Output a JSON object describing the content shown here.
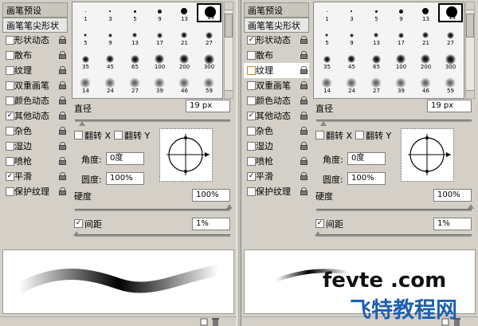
{
  "panels": [
    {
      "sidebar": [
        {
          "label": "画笔预设",
          "kind": "head"
        },
        {
          "label": "画笔笔尖形状",
          "kind": "selected"
        },
        {
          "label": "形状动态",
          "checked": false,
          "lock": true
        },
        {
          "label": "散布",
          "checked": false,
          "lock": true
        },
        {
          "label": "纹理",
          "checked": false,
          "lock": true
        },
        {
          "label": "双重画笔",
          "checked": false,
          "lock": true
        },
        {
          "label": "颜色动态",
          "checked": false,
          "lock": true
        },
        {
          "label": "其他动态",
          "checked": true,
          "lock": true
        },
        {
          "label": "杂色",
          "checked": false,
          "lock": true
        },
        {
          "label": "湿边",
          "checked": false,
          "lock": true
        },
        {
          "label": "喷枪",
          "checked": false,
          "lock": true
        },
        {
          "label": "平滑",
          "checked": true,
          "lock": true
        },
        {
          "label": "保护纹理",
          "checked": false,
          "lock": true
        }
      ],
      "brushes": [
        "1",
        "3",
        "5",
        "9",
        "13",
        "19",
        "5",
        "9",
        "13",
        "17",
        "21",
        "27",
        "35",
        "45",
        "65",
        "100",
        "200",
        "300",
        "14",
        "24",
        "27",
        "39",
        "46",
        "59"
      ],
      "diameter_label": "直径",
      "diameter_value": "19 px",
      "flip_x": "翻转 X",
      "flip_y": "翻转 Y",
      "angle_label": "角度:",
      "angle_value": "0度",
      "roundness_label": "圆度:",
      "roundness_value": "100%",
      "hardness_label": "硬度",
      "hardness_value": "100%",
      "spacing_label": "间距",
      "spacing_value": "1%",
      "spacing_checked": true
    },
    {
      "sidebar": [
        {
          "label": "画笔预设",
          "kind": "head"
        },
        {
          "label": "画笔笔尖形状",
          "kind": "selected"
        },
        {
          "label": "形状动态",
          "checked": true,
          "lock": true
        },
        {
          "label": "散布",
          "checked": false,
          "lock": true
        },
        {
          "label": "纹理",
          "checked": false,
          "lock": true,
          "highlight": true
        },
        {
          "label": "双重画笔",
          "checked": false,
          "lock": true
        },
        {
          "label": "颜色动态",
          "checked": false,
          "lock": true
        },
        {
          "label": "其他动态",
          "checked": true,
          "lock": true
        },
        {
          "label": "杂色",
          "checked": false,
          "lock": true
        },
        {
          "label": "湿边",
          "checked": false,
          "lock": true
        },
        {
          "label": "喷枪",
          "checked": false,
          "lock": true
        },
        {
          "label": "平滑",
          "checked": true,
          "lock": true
        },
        {
          "label": "保护纹理",
          "checked": false,
          "lock": true
        }
      ],
      "brushes": [
        "1",
        "3",
        "5",
        "9",
        "13",
        "19",
        "5",
        "9",
        "13",
        "17",
        "21",
        "27",
        "35",
        "45",
        "65",
        "100",
        "200",
        "300",
        "14",
        "24",
        "27",
        "39",
        "46",
        "59"
      ],
      "diameter_label": "直径",
      "diameter_value": "19 px",
      "flip_x": "翻转 X",
      "flip_y": "翻转 Y",
      "angle_label": "角度:",
      "angle_value": "0度",
      "roundness_label": "圆度:",
      "roundness_value": "100%",
      "hardness_label": "硬度",
      "hardness_value": "100%",
      "spacing_label": "间距",
      "spacing_value": "1%",
      "spacing_checked": true
    }
  ],
  "watermark": {
    "domain": "fevte .com",
    "name": "飞特教程网"
  },
  "colors": {
    "panel": "#d4d0c8",
    "watermark_blue": "#1e5fb0",
    "watermark_black": "#111111"
  },
  "icons": [
    "lock-icon",
    "checkbox-icon",
    "brush-tip-icon",
    "scroll-arrow-icon",
    "new-brush-icon",
    "trash-icon"
  ]
}
